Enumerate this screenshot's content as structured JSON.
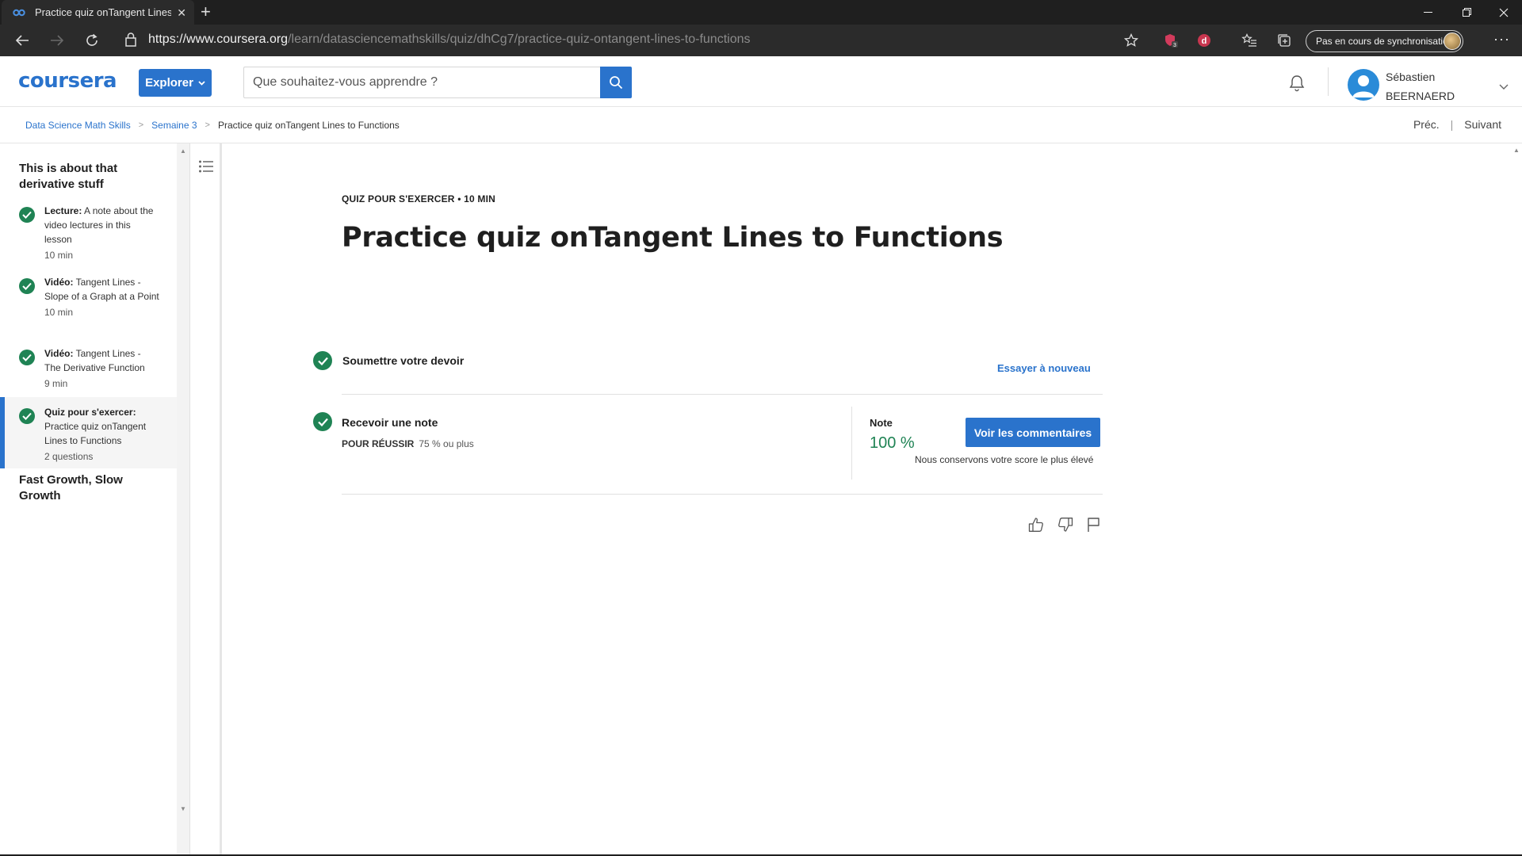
{
  "browser": {
    "tab_title": "Practice quiz onTangent Lines to",
    "url_prefix": "https://",
    "url_host": "www.coursera.org",
    "url_path": "/learn/datasciencemathskills/quiz/dhCg7/practice-quiz-ontangent-lines-to-functions",
    "sync_label": "Pas en cours de synchronisation",
    "ext_badge": "3"
  },
  "header": {
    "logo": "coursera",
    "explore_label": "Explorer",
    "search_placeholder": "Que souhaitez-vous apprendre ?",
    "user_first": "Sébastien",
    "user_last": "BEERNAERD"
  },
  "breadcrumb": {
    "items": [
      "Data Science Math Skills",
      "Semaine 3",
      "Practice quiz onTangent Lines to Functions"
    ],
    "prev": "Préc.",
    "next": "Suivant"
  },
  "sidebar": {
    "module_title": "This is about that derivative stuff",
    "items": [
      {
        "type": "Lecture:",
        "title": "A note about the video lectures in this lesson",
        "meta": "10  min"
      },
      {
        "type": "Vidéo:",
        "title": "Tangent Lines - Slope of a Graph at a Point",
        "meta": "10  min"
      },
      {
        "type": "Vidéo:",
        "title": "Tangent Lines - The Derivative Function",
        "meta": "9  min"
      },
      {
        "type": "Quiz pour s'exercer:",
        "title": "Practice quiz onTangent Lines to Functions",
        "meta": "2 questions"
      }
    ],
    "next_module": "Fast Growth, Slow Growth"
  },
  "main": {
    "kicker": "QUIZ POUR S'EXERCER • 10  MIN",
    "title": "Practice quiz onTangent Lines to Functions",
    "step1_title": "Soumettre votre devoir",
    "retry_label": "Essayer à nouveau",
    "step2_title": "Recevoir une note",
    "pass_label": "POUR RÉUSSIR",
    "pass_value": "75 % ou plus",
    "grade_label": "Note",
    "grade_value": "100 %",
    "feedback_button": "Voir les commentaires",
    "keep_text": "Nous conservons votre score le plus élevé"
  },
  "colors": {
    "accent": "#2a73cc",
    "success": "#1f8354"
  }
}
